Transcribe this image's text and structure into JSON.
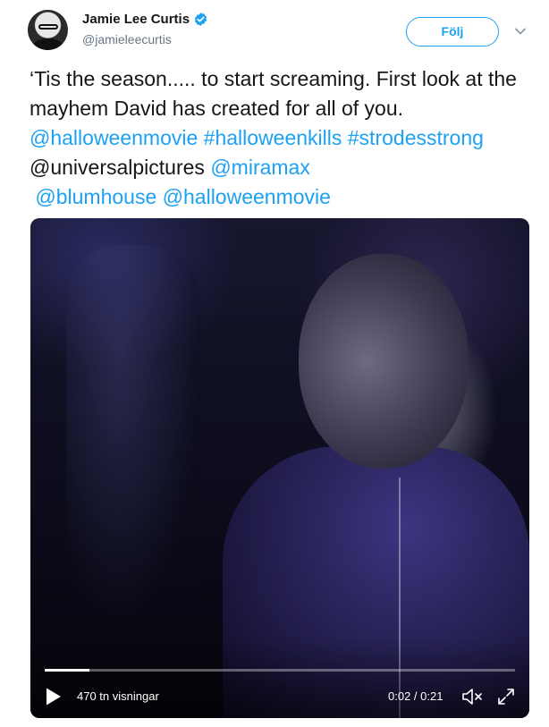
{
  "author": {
    "name": "Jamie Lee Curtis",
    "handle": "@jamieleecurtis",
    "verified": true
  },
  "actions": {
    "follow_label": "Följ",
    "menu_icon": "chevron-down-icon"
  },
  "tweet": {
    "text_plain_1": "‘Tis the season..... to start screaming. First look at the mayhem David has created for all of you. ",
    "mention_1": "@halloweenmovie",
    "hashtag_1": "#halloweenkills",
    "hashtag_2": "#strodesstrong",
    "mention_plain": "@universalpictures",
    "mention_2": "@miramax",
    "mention_3": "@blumhouse",
    "mention_4": "@halloweenmovie"
  },
  "video": {
    "views": "470 tn visningar",
    "timecode": "0:02 / 0:21",
    "progress": 0.095,
    "icons": [
      "play-icon",
      "volume-muted-icon",
      "fullscreen-icon"
    ]
  },
  "colors": {
    "link": "#1da1f2",
    "text": "#14171a",
    "secondary": "#657786"
  }
}
